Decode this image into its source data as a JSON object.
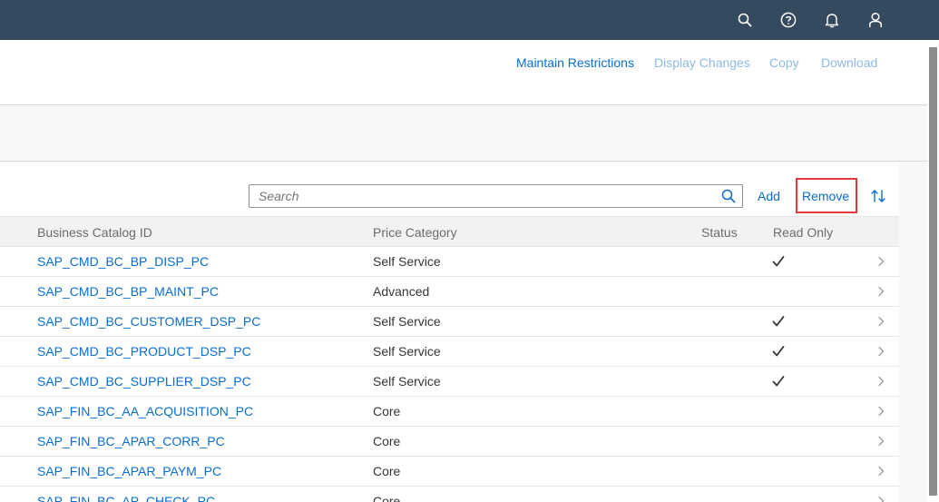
{
  "shell": {
    "icons": [
      "search-icon",
      "help-icon",
      "bell-icon",
      "user-icon"
    ]
  },
  "header": {
    "actions": {
      "maintain_restrictions": "Maintain Restrictions",
      "display_changes": "Display Changes",
      "copy": "Copy",
      "download": "Download"
    }
  },
  "toolbar": {
    "search_placeholder": "Search",
    "add_label": "Add",
    "remove_label": "Remove",
    "sort_icon": "sort-icon"
  },
  "table": {
    "columns": {
      "catalog_id": "Business Catalog ID",
      "price_category": "Price Category",
      "status": "Status",
      "read_only": "Read Only"
    },
    "rows": [
      {
        "catalog_id": "SAP_CMD_BC_BP_DISP_PC",
        "price_category": "Self Service",
        "status": "",
        "read_only": true
      },
      {
        "catalog_id": "SAP_CMD_BC_BP_MAINT_PC",
        "price_category": "Advanced",
        "status": "",
        "read_only": false
      },
      {
        "catalog_id": "SAP_CMD_BC_CUSTOMER_DSP_PC",
        "price_category": "Self Service",
        "status": "",
        "read_only": true
      },
      {
        "catalog_id": "SAP_CMD_BC_PRODUCT_DSP_PC",
        "price_category": "Self Service",
        "status": "",
        "read_only": true
      },
      {
        "catalog_id": "SAP_CMD_BC_SUPPLIER_DSP_PC",
        "price_category": "Self Service",
        "status": "",
        "read_only": true
      },
      {
        "catalog_id": "SAP_FIN_BC_AA_ACQUISITION_PC",
        "price_category": "Core",
        "status": "",
        "read_only": false
      },
      {
        "catalog_id": "SAP_FIN_BC_APAR_CORR_PC",
        "price_category": "Core",
        "status": "",
        "read_only": false
      },
      {
        "catalog_id": "SAP_FIN_BC_APAR_PAYM_PC",
        "price_category": "Core",
        "status": "",
        "read_only": false
      },
      {
        "catalog_id": "SAP_FIN_BC_AP_CHECK_PC",
        "price_category": "Core",
        "status": "",
        "read_only": false
      }
    ]
  },
  "colors": {
    "shell_bar": "#354a5f",
    "link": "#0a6ed1",
    "highlight": "#e0393e"
  }
}
